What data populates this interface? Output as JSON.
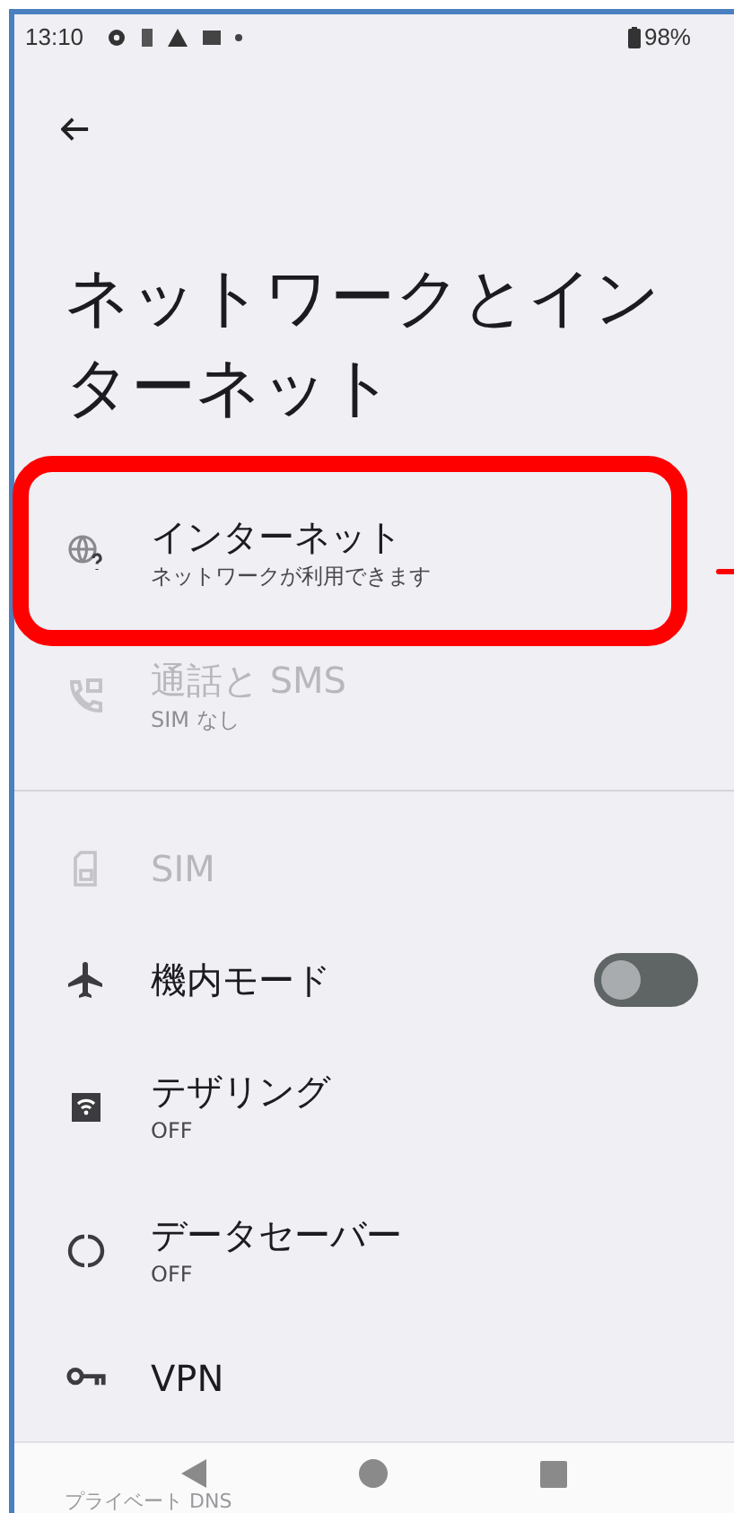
{
  "status_bar": {
    "time": "13:10",
    "battery": "98%"
  },
  "title": "ネットワークとインターネット",
  "items": [
    {
      "kind": "internet",
      "title": "インターネット",
      "subtitle": "ネットワークが利用できます",
      "disabled": false,
      "highlighted": true
    },
    {
      "kind": "calls",
      "title": "通話と SMS",
      "subtitle": "SIM なし",
      "disabled": true,
      "highlighted": false
    },
    {
      "kind": "divider"
    },
    {
      "kind": "sim",
      "title": "SIM",
      "disabled": true,
      "highlighted": false
    },
    {
      "kind": "airplane",
      "title": "機内モード",
      "disabled": false,
      "highlighted": false,
      "on": false
    },
    {
      "kind": "tethering",
      "title": "テザリング",
      "subtitle": "OFF",
      "disabled": false,
      "highlighted": false
    },
    {
      "kind": "datasaver",
      "title": "データセーバー",
      "subtitle": "OFF",
      "disabled": false,
      "highlighted": false
    },
    {
      "kind": "vpn",
      "title": "VPN",
      "disabled": false,
      "highlighted": false
    }
  ],
  "hidden_item": {
    "title": "プライベート DNS"
  }
}
